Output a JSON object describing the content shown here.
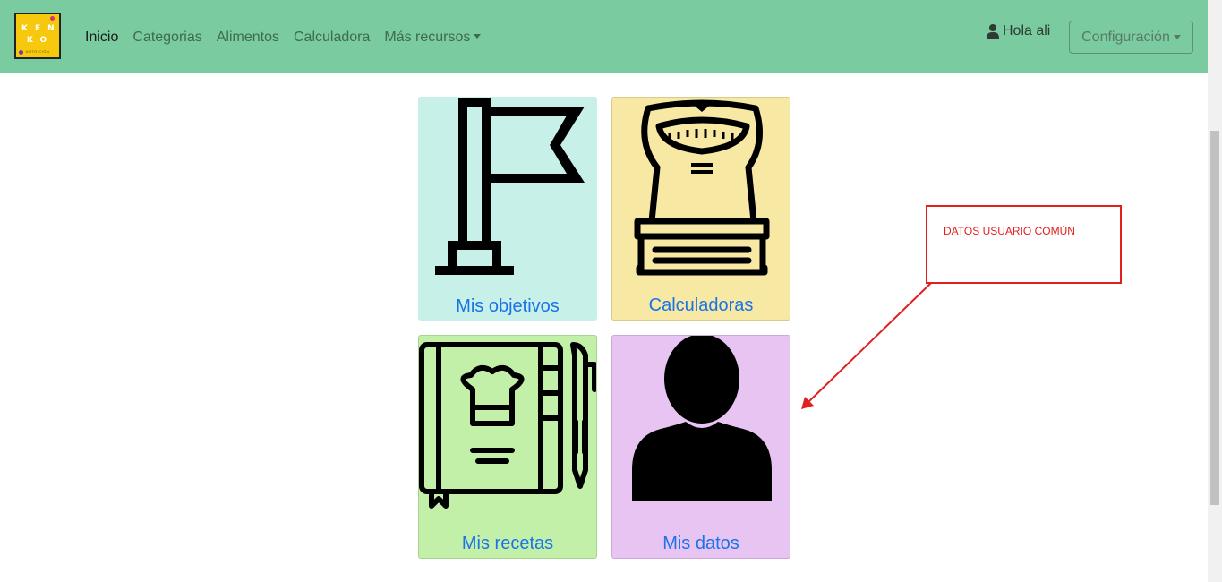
{
  "logo": {
    "line1": "KEN",
    "line2": "KO",
    "sub": "NUTRICIÓN"
  },
  "nav": {
    "items": [
      "Inicio",
      "Categorias",
      "Alimentos",
      "Calculadora",
      "Más recursos"
    ]
  },
  "user": {
    "greeting": "Hola ali",
    "icon": "user-icon"
  },
  "config": {
    "label": "Configuración"
  },
  "cards": [
    {
      "label": "Mis objetivos",
      "icon": "flag-icon",
      "color": "#c7f0e8"
    },
    {
      "label": "Calculadoras",
      "icon": "scale-icon",
      "color": "#f7e8a3"
    },
    {
      "label": "Mis recetas",
      "icon": "recipe-book-icon",
      "color": "#c3f0a8"
    },
    {
      "label": "Mis datos",
      "icon": "profile-icon",
      "color": "#e8c4f3"
    }
  ],
  "annotation": {
    "text": "DATOS USUARIO COMÚN",
    "color": "#e21f1f"
  },
  "colors": {
    "navbar": "#7acb9f",
    "link": "#1a73e8"
  }
}
